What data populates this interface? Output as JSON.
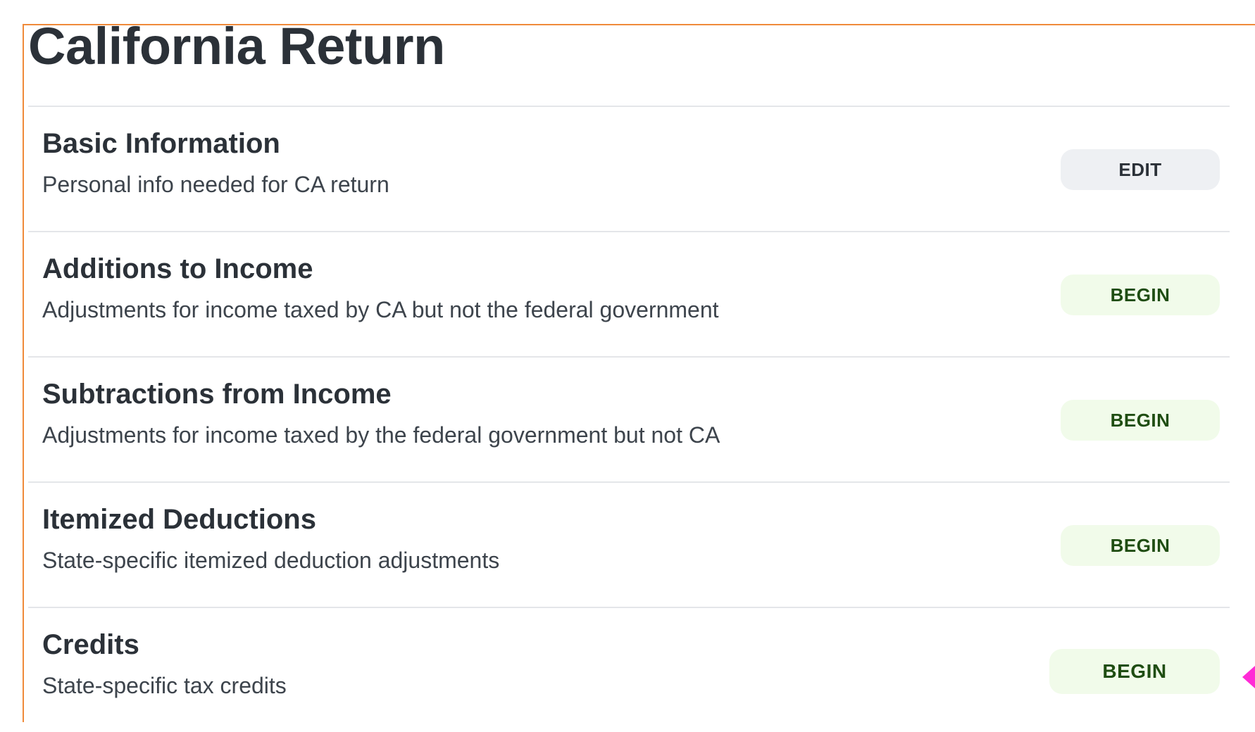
{
  "page": {
    "title": "California Return"
  },
  "sections": [
    {
      "title": "Basic Information",
      "description": "Personal info needed for CA return",
      "action_label": "EDIT",
      "action_type": "edit"
    },
    {
      "title": "Additions to Income",
      "description": "Adjustments for income taxed by CA but not the federal government",
      "action_label": "BEGIN",
      "action_type": "begin"
    },
    {
      "title": "Subtractions from Income",
      "description": "Adjustments for income taxed by the federal government but not CA",
      "action_label": "BEGIN",
      "action_type": "begin"
    },
    {
      "title": "Itemized Deductions",
      "description": "State-specific itemized deduction adjustments",
      "action_label": "BEGIN",
      "action_type": "begin"
    },
    {
      "title": "Credits",
      "description": "State-specific tax credits",
      "action_label": "BEGIN",
      "action_type": "begin"
    }
  ],
  "colors": {
    "frame_accent": "#ef8a3a",
    "edit_button_bg": "#eef0f3",
    "begin_button_bg": "#f1fbea",
    "begin_button_text": "#1f4d12",
    "cursor_marker": "#ff2bd6"
  }
}
